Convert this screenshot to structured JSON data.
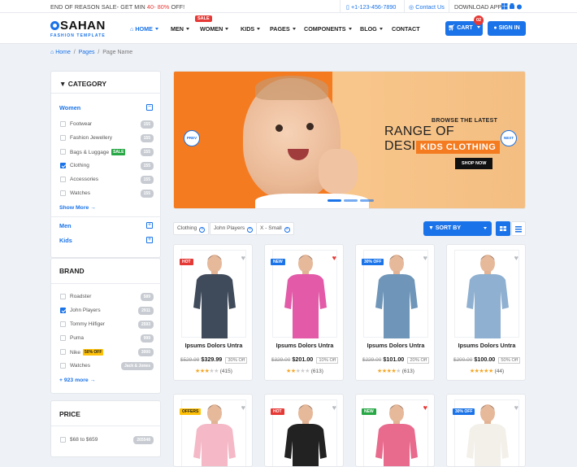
{
  "topbar": {
    "promo_prefix": "END OF REASON SALE- GET MIN ",
    "promo_min": "40-",
    "promo_mid": " ",
    "promo_max": "80%",
    "promo_suffix": " OFF!",
    "phone": "+1-123-456-7890",
    "contact": "Contact Us",
    "download": "DOWNLOAD APP"
  },
  "logo": {
    "name": "SAHAN",
    "tagline": "FASHION TEMPLATE"
  },
  "menu": {
    "home": "HOME",
    "men": "MEN",
    "women": "WOMEN",
    "kids": "KIDS",
    "pages": "PAGES",
    "components": "COMPONENTS",
    "blog": "BLOG",
    "contact": "CONTACT",
    "sale_badge": "SALE"
  },
  "actions": {
    "cart": "CART",
    "cart_count": "02",
    "signin": "SIGN IN"
  },
  "breadcrumb": {
    "home": "Home",
    "sep": "/",
    "pages": "Pages",
    "current": "Page Name"
  },
  "category": {
    "title": "CATEGORY",
    "women": "Women",
    "men": "Men",
    "kids": "Kids",
    "show_more": "Show More",
    "items": [
      {
        "label": "Footwear",
        "count": "155",
        "checked": false
      },
      {
        "label": "Fashion Jewellery",
        "count": "155",
        "checked": false
      },
      {
        "label": "Bags & Luggage",
        "count": "155",
        "checked": false,
        "tag": "SALE"
      },
      {
        "label": "Clothing",
        "count": "155",
        "checked": true
      },
      {
        "label": "Accessories",
        "count": "155",
        "checked": false
      },
      {
        "label": "Watches",
        "count": "155",
        "checked": false
      }
    ]
  },
  "brand": {
    "title": "BRAND",
    "more": "+ 923 more",
    "items": [
      {
        "label": "Roadster",
        "count": "589"
      },
      {
        "label": "John Players",
        "count": "2911"
      },
      {
        "label": "Tommy Hilfiger",
        "count": "2593"
      },
      {
        "label": "Puma",
        "count": "999"
      },
      {
        "label": "Nike",
        "count": "3000",
        "tag": "50% OFF"
      },
      {
        "label": "Watches",
        "count": "Jack & Jones"
      }
    ]
  },
  "price": {
    "title": "PRICE",
    "range": "$68 to $659",
    "count": "265548"
  },
  "banner": {
    "line1": "BROWSE THE LATEST",
    "line2": "RANGE OF DESIGNER",
    "line3": "KIDS CLOTHING",
    "button": "SHOP NOW",
    "prev": "PREV",
    "next": "NEXT"
  },
  "filters": {
    "chip1": "Clothing",
    "chip2": "John Players",
    "chip3": "X - Small",
    "sort": "SORT BY"
  },
  "products": [
    {
      "badge": "HOT",
      "badge_color": "#e53935",
      "title": "Ipsums Dolors Untra",
      "old": "$529.99",
      "price": "$329.99",
      "off": "30% Off",
      "stars": 3,
      "reviews": "(415)",
      "liked": false,
      "shirt": "#3f4a5a"
    },
    {
      "badge": "NEW",
      "badge_color": "#1a73e8",
      "title": "Ipsums Dolors Untra",
      "old": "$329.00",
      "price": "$201.00",
      "off": "10% Off",
      "stars": 2,
      "reviews": "(613)",
      "liked": true,
      "shirt": "#e25aa8"
    },
    {
      "badge": "30% OFF",
      "badge_color": "#1a73e8",
      "title": "Ipsums Dolors Untra",
      "old": "$229.00",
      "price": "$101.00",
      "off": "20% Off",
      "stars": 4,
      "reviews": "(613)",
      "liked": false,
      "shirt": "#6f96b8"
    },
    {
      "badge": "",
      "badge_color": "",
      "title": "Ipsums Dolors Untra",
      "old": "$200.00",
      "price": "$100.00",
      "off": "50% Off",
      "stars": 5,
      "reviews": "(44)",
      "liked": false,
      "shirt": "#8fb0d0"
    },
    {
      "badge": "OFFERS",
      "badge_color": "#ffc107",
      "shirt": "#f4b8c6",
      "liked": false
    },
    {
      "badge": "HOT",
      "badge_color": "#e53935",
      "shirt": "#222222",
      "liked": false
    },
    {
      "badge": "NEW",
      "badge_color": "#28a745",
      "shirt": "#e86a8d",
      "liked": true
    },
    {
      "badge": "30% OFF",
      "badge_color": "#1a73e8",
      "shirt": "#f3f0ea",
      "liked": false
    }
  ]
}
